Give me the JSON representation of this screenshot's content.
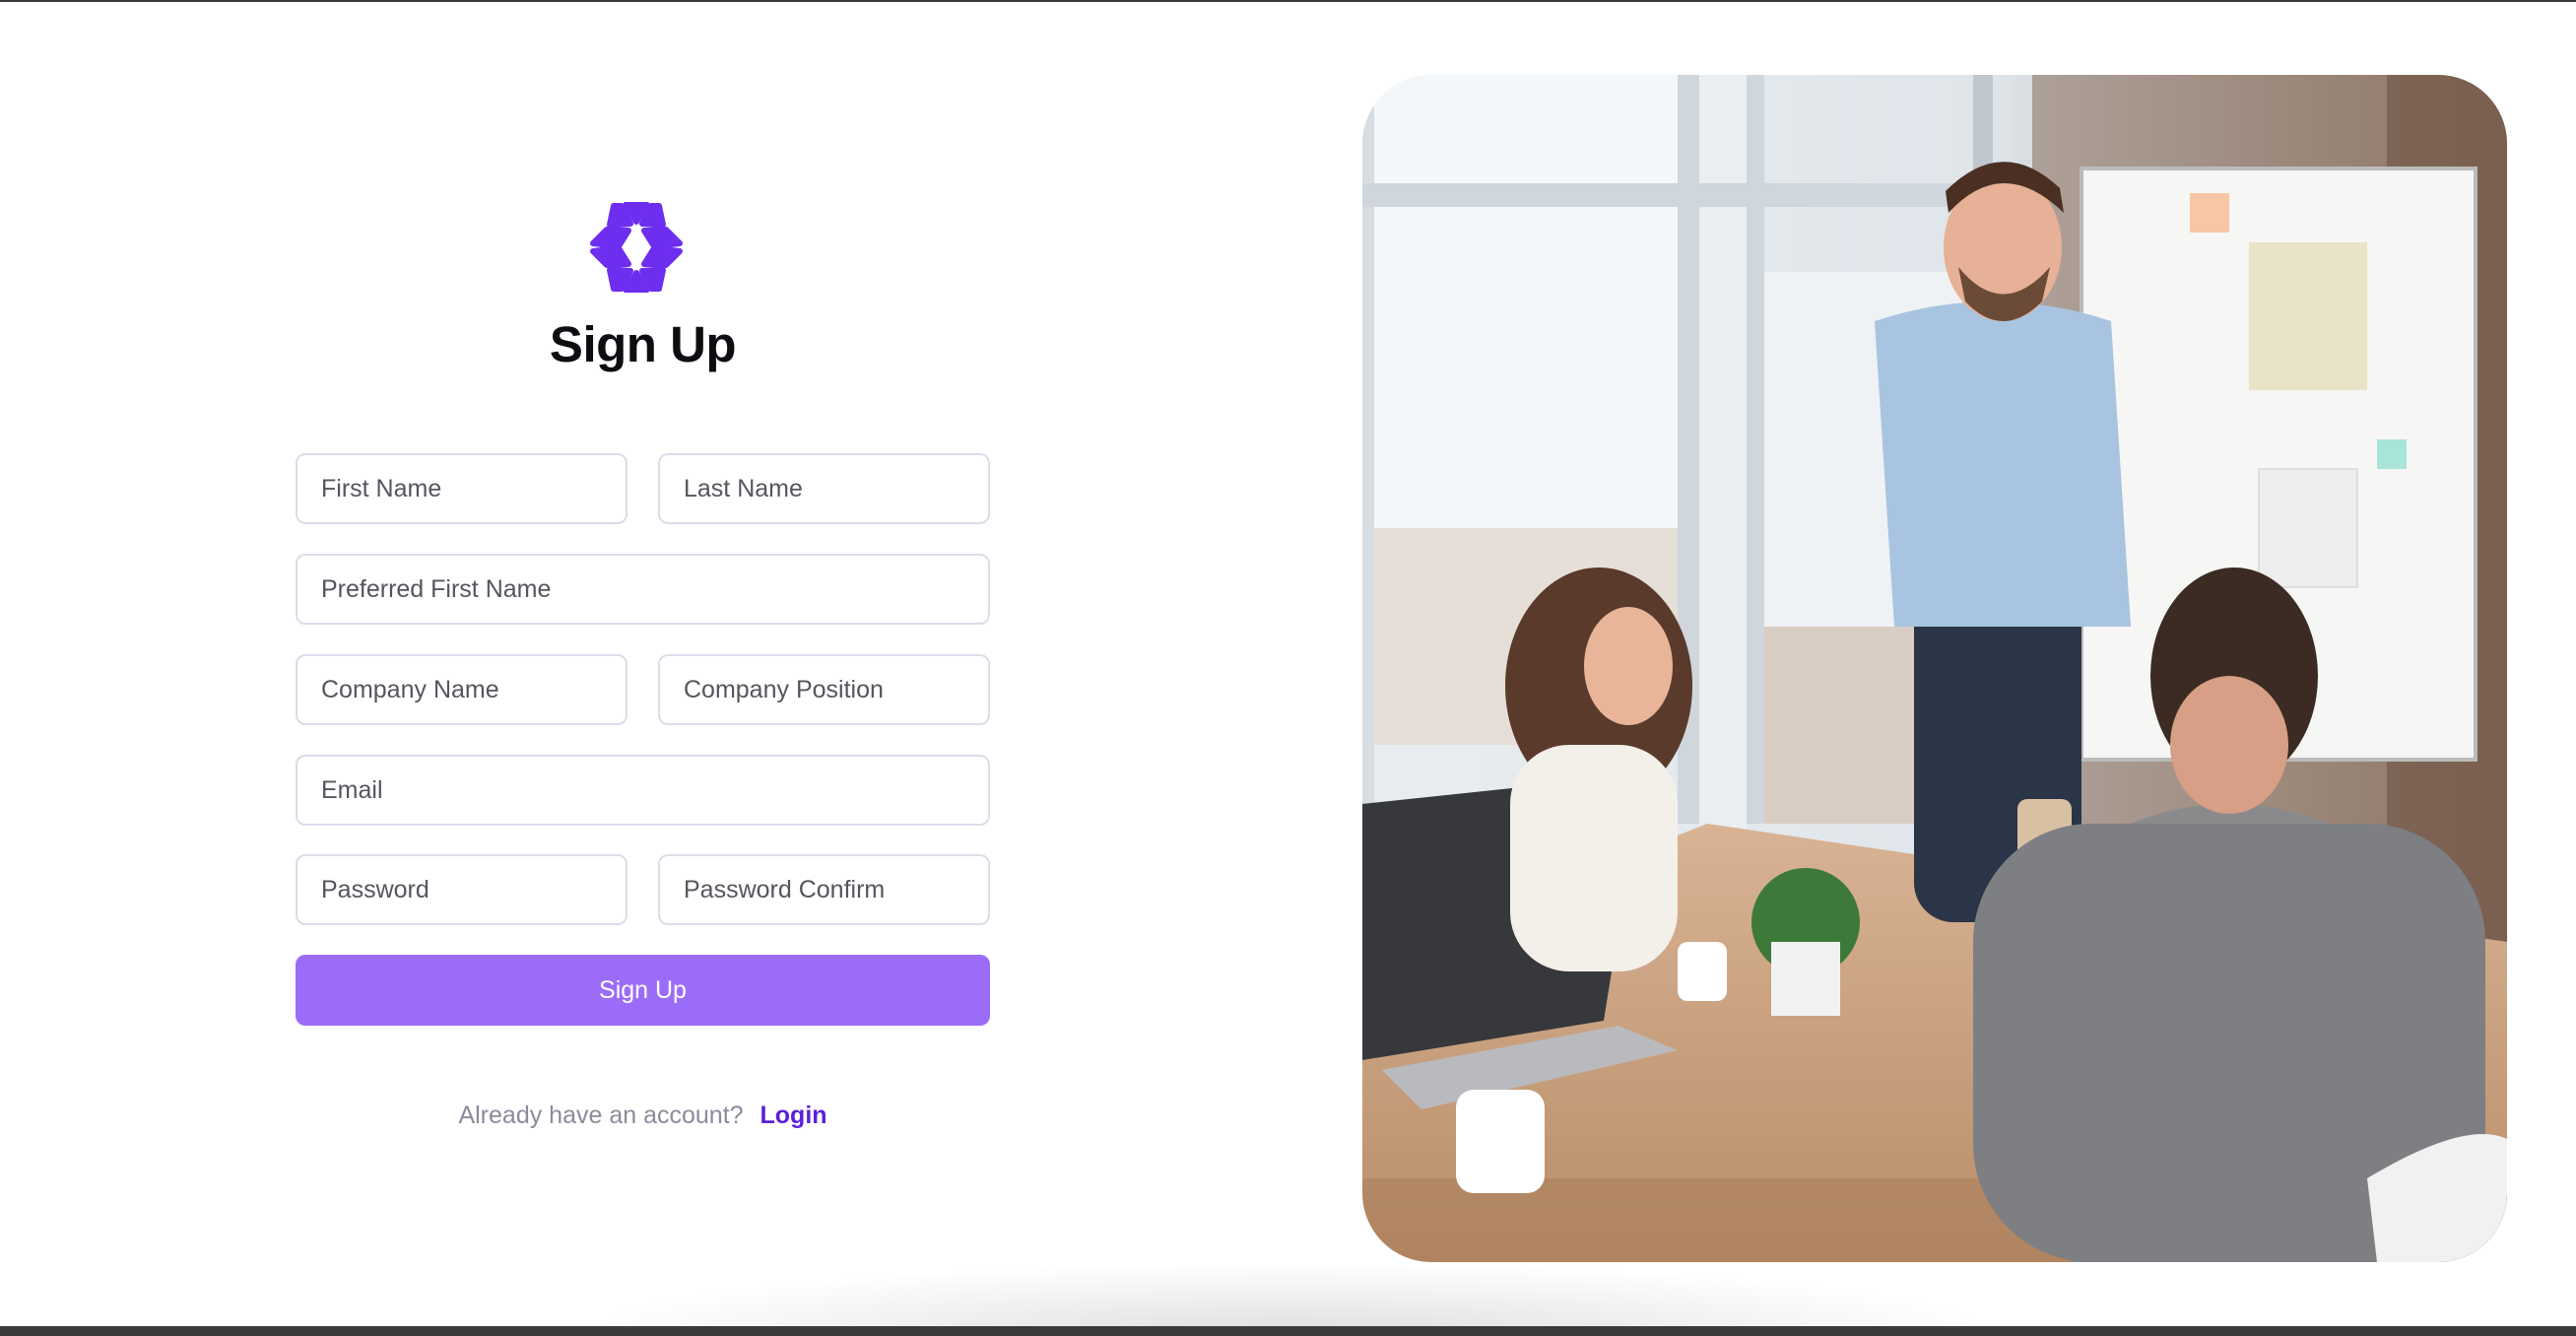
{
  "page": {
    "title": "Sign Up"
  },
  "brand": {
    "accent": "#9b6cf7",
    "logo_color": "#6d2ef0",
    "link_color": "#5b1fd8",
    "logo_icon": "hexagon-triangles-icon"
  },
  "form": {
    "first_name_placeholder": "First Name",
    "last_name_placeholder": "Last Name",
    "preferred_first_name_placeholder": "Preferred First Name",
    "company_name_placeholder": "Company Name",
    "company_position_placeholder": "Company Position",
    "email_placeholder": "Email",
    "password_placeholder": "Password",
    "password_confirm_placeholder": "Password Confirm",
    "submit_label": "Sign Up"
  },
  "footer": {
    "prompt": "Already have an account?",
    "login_label": "Login"
  },
  "hero_image": {
    "description_icon": "office-meeting-photo"
  }
}
